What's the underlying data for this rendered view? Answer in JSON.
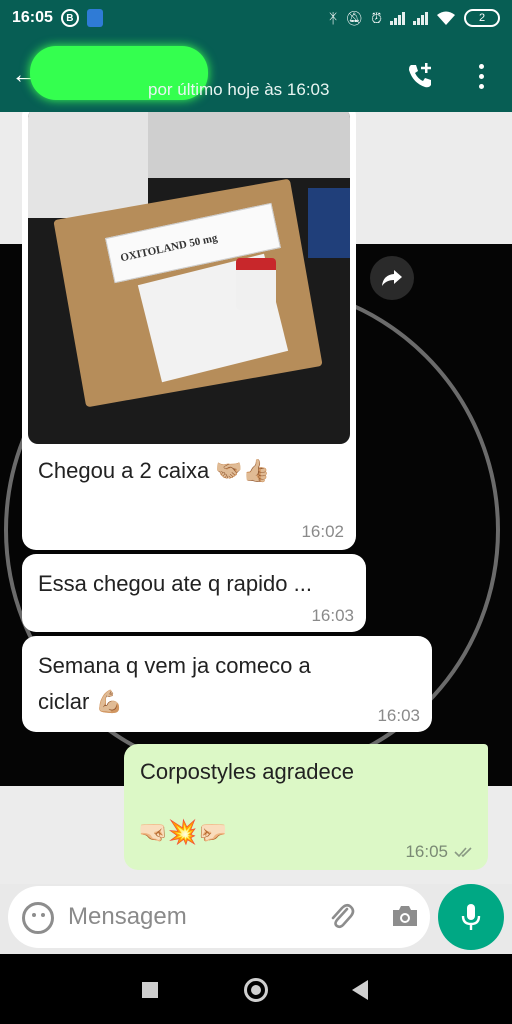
{
  "status_bar": {
    "time": "16:05",
    "badge_b": "B",
    "battery": "2"
  },
  "header": {
    "contact_name": "",
    "last_seen": "por último hoje às 16:03"
  },
  "messages": [
    {
      "direction": "incoming",
      "type": "image",
      "image_product_label": "OXITOLAND 50 mg",
      "caption": "Chegou a 2 caixa 🤝🏼👍🏼",
      "time": "16:02"
    },
    {
      "direction": "incoming",
      "type": "text",
      "text": "Essa chegou ate q rapido ...",
      "time": "16:03"
    },
    {
      "direction": "incoming",
      "type": "text",
      "text_line1": "Semana q vem ja comeco a",
      "text_line2": "ciclar 💪🏼",
      "time": "16:03"
    },
    {
      "direction": "outgoing",
      "type": "text",
      "text": "Corpostyles agradece",
      "emoji": "🤜🏻💥🤛🏻",
      "time": "16:05",
      "status": "read"
    }
  ],
  "input": {
    "placeholder": "Mensagem"
  },
  "colors": {
    "header": "#075e54",
    "outgoing_bubble": "#dcf8c6",
    "incoming_bubble": "#ffffff",
    "mic_button": "#00a884",
    "name_highlight": "#34ff4f"
  },
  "icons": [
    "back-arrow-icon",
    "add-call-icon",
    "more-vert-icon",
    "forward-icon",
    "emoji-icon",
    "attach-icon",
    "camera-icon",
    "mic-icon",
    "double-check-icon",
    "bluetooth-icon",
    "mute-icon",
    "alarm-icon",
    "signal-icon",
    "wifi-icon",
    "battery-icon"
  ]
}
